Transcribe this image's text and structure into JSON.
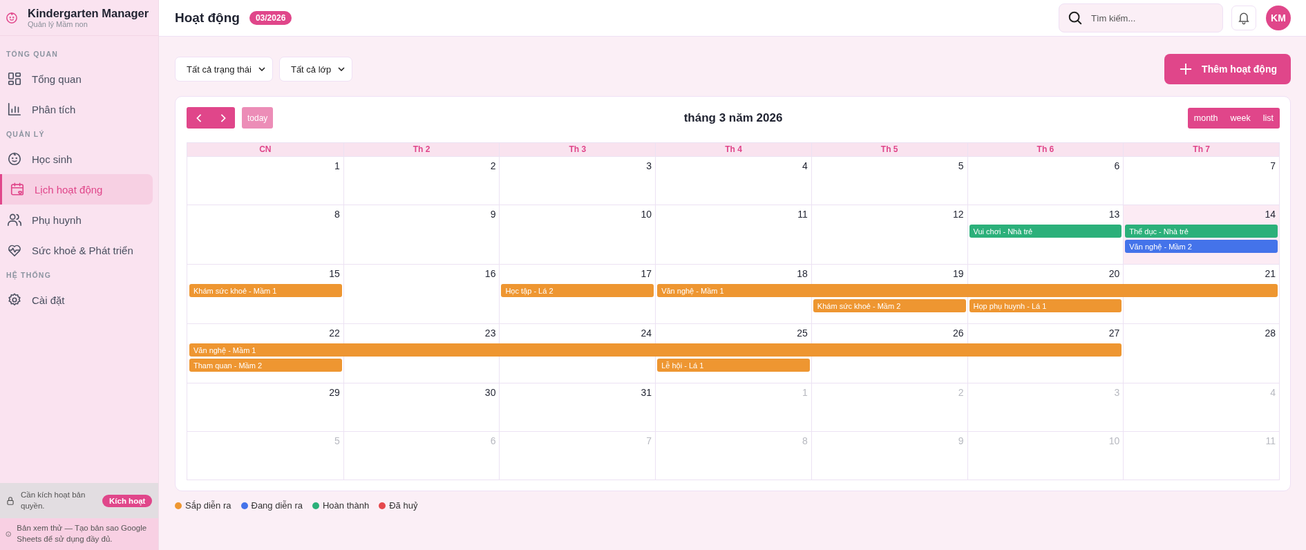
{
  "app": {
    "title": "Kindergarten Manager",
    "subtitle": "Quản lý Mầm non"
  },
  "sidebar": {
    "sections": [
      {
        "label": "TỔNG QUAN",
        "items": [
          {
            "label": "Tổng quan",
            "selected": false
          },
          {
            "label": "Phân tích",
            "selected": false
          }
        ]
      },
      {
        "label": "QUẢN LÝ",
        "items": [
          {
            "label": "Học sinh",
            "selected": false
          },
          {
            "label": "Lịch hoạt động",
            "selected": true
          },
          {
            "label": "Phụ huynh",
            "selected": false
          },
          {
            "label": "Sức khoẻ & Phát triển",
            "selected": false
          }
        ]
      },
      {
        "label": "HỆ THỐNG",
        "items": [
          {
            "label": "Cài đặt",
            "selected": false
          }
        ]
      }
    ],
    "license": {
      "text": "Cần kích hoạt bản quyền.",
      "button": "Kích hoạt"
    },
    "notice": "Bản xem thử — Tạo bản sao Google Sheets để sử dụng đầy đủ."
  },
  "header": {
    "title": "Hoạt động",
    "badge": "03/2026",
    "search": {
      "placeholder": "Tìm kiếm..."
    },
    "avatar": "KM"
  },
  "filters": [
    {
      "value": "Tất cả trạng thái"
    },
    {
      "value": "Tất cả lớp"
    }
  ],
  "add_button": "Thêm hoạt động",
  "calendar": {
    "today_button": "today",
    "title": "tháng 3 năm 2026",
    "views": [
      "month",
      "week",
      "list"
    ],
    "weekdays": [
      "CN",
      "Th 2",
      "Th 3",
      "Th 4",
      "Th 5",
      "Th 6",
      "Th 7"
    ],
    "weeks": [
      {
        "days": [
          {
            "label": "1",
            "other_month": false,
            "today": false
          },
          {
            "label": "2",
            "other_month": false,
            "today": false
          },
          {
            "label": "3",
            "other_month": false,
            "today": false
          },
          {
            "label": "4",
            "other_month": false,
            "today": false
          },
          {
            "label": "5",
            "other_month": false,
            "today": false
          },
          {
            "label": "6",
            "other_month": false,
            "today": false
          },
          {
            "label": "7",
            "other_month": false,
            "today": false
          }
        ]
      },
      {
        "days": [
          {
            "label": "8",
            "other_month": false,
            "today": false
          },
          {
            "label": "9",
            "other_month": false,
            "today": false
          },
          {
            "label": "10",
            "other_month": false,
            "today": false
          },
          {
            "label": "11",
            "other_month": false,
            "today": false
          },
          {
            "label": "12",
            "other_month": false,
            "today": false
          },
          {
            "label": "13",
            "other_month": false,
            "today": false,
            "events": [
              {
                "kind": "start",
                "title": "Vui chơi - Nhà trẻ",
                "color": "#2bb07a"
              }
            ]
          },
          {
            "label": "14",
            "other_month": false,
            "today": true,
            "events": [
              {
                "kind": "start",
                "title": "Thể dục - Nhà trẻ",
                "color": "#2bb07a"
              },
              {
                "kind": "start",
                "title": "Văn nghệ - Mầm 2",
                "color": "#4473ea"
              }
            ]
          }
        ]
      },
      {
        "days": [
          {
            "label": "15",
            "other_month": false,
            "today": false,
            "events": [
              {
                "kind": "start",
                "title": "Khám sức khoẻ - Mầm 1",
                "color": "#ee9631"
              }
            ]
          },
          {
            "label": "16",
            "other_month": false,
            "today": false
          },
          {
            "label": "17",
            "other_month": false,
            "today": false,
            "events": [
              {
                "kind": "start",
                "title": "Học tập - Lá 2",
                "color": "#ee9631"
              }
            ]
          },
          {
            "label": "18",
            "other_month": false,
            "today": false,
            "events": [
              {
                "kind": "start",
                "title": "Văn nghệ - Mầm 1",
                "color": "#ee9631"
              }
            ]
          },
          {
            "label": "19",
            "other_month": false,
            "today": false,
            "events": [
              {
                "kind": "continuation"
              },
              {
                "kind": "start",
                "title": "Khám sức khoẻ - Mầm 2",
                "color": "#ee9631"
              }
            ]
          },
          {
            "label": "20",
            "other_month": false,
            "today": false,
            "events": [
              {
                "kind": "continuation"
              },
              {
                "kind": "start",
                "title": "Họp phụ huynh - Lá 1",
                "color": "#ee9631"
              }
            ]
          },
          {
            "label": "21",
            "other_month": false,
            "today": false,
            "events": [
              {
                "kind": "continuation"
              }
            ]
          }
        ]
      },
      {
        "days": [
          {
            "label": "22",
            "other_month": false,
            "today": false,
            "events": [
              {
                "kind": "start",
                "title": "Văn nghệ - Mầm 1",
                "color": "#ee9631"
              },
              {
                "kind": "start",
                "title": "Tham quan - Mầm 2",
                "color": "#ee9631"
              }
            ]
          },
          {
            "label": "23",
            "other_month": false,
            "today": false,
            "events": [
              {
                "kind": "continuation"
              }
            ]
          },
          {
            "label": "24",
            "other_month": false,
            "today": false,
            "events": [
              {
                "kind": "continuation"
              }
            ]
          },
          {
            "label": "25",
            "other_month": false,
            "today": false,
            "events": [
              {
                "kind": "continuation"
              },
              {
                "kind": "start",
                "title": "Lễ hội - Lá 1",
                "color": "#ee9631"
              }
            ]
          },
          {
            "label": "26",
            "other_month": false,
            "today": false,
            "events": [
              {
                "kind": "continuation"
              }
            ]
          },
          {
            "label": "27",
            "other_month": false,
            "today": false,
            "events": [
              {
                "kind": "continuation"
              }
            ]
          },
          {
            "label": "28",
            "other_month": false,
            "today": false
          }
        ]
      },
      {
        "days": [
          {
            "label": "29",
            "other_month": false,
            "today": false
          },
          {
            "label": "30",
            "other_month": false,
            "today": false
          },
          {
            "label": "31",
            "other_month": false,
            "today": false
          },
          {
            "label": "1",
            "other_month": true,
            "today": false
          },
          {
            "label": "2",
            "other_month": true,
            "today": false
          },
          {
            "label": "3",
            "other_month": true,
            "today": false
          },
          {
            "label": "4",
            "other_month": true,
            "today": false
          }
        ]
      },
      {
        "days": [
          {
            "label": "5",
            "other_month": true,
            "today": false
          },
          {
            "label": "6",
            "other_month": true,
            "today": false
          },
          {
            "label": "7",
            "other_month": true,
            "today": false
          },
          {
            "label": "8",
            "other_month": true,
            "today": false
          },
          {
            "label": "9",
            "other_month": true,
            "today": false
          },
          {
            "label": "10",
            "other_month": true,
            "today": false
          },
          {
            "label": "11",
            "other_month": true,
            "today": false
          }
        ]
      }
    ]
  },
  "legend": [
    {
      "label": "Sắp diễn ra",
      "color": "#ee9631"
    },
    {
      "label": "Đang diễn ra",
      "color": "#4473ea"
    },
    {
      "label": "Hoàn thành",
      "color": "#2bb07a"
    },
    {
      "label": "Đã huỷ",
      "color": "#e5484d"
    }
  ]
}
